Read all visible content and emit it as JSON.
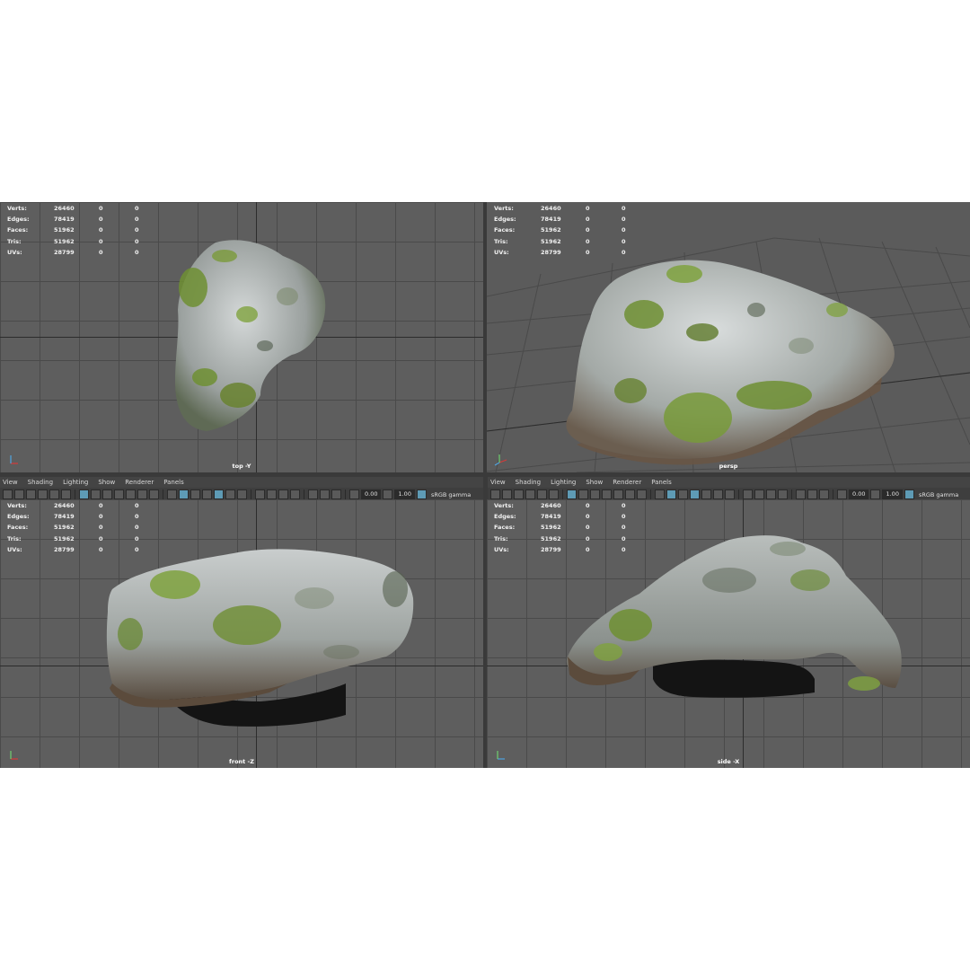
{
  "menu": [
    "View",
    "Shading",
    "Lighting",
    "Show",
    "Renderer",
    "Panels"
  ],
  "toolbar": {
    "exposure": "0.00",
    "gamma": "1.00",
    "color_space": "sRGB gamma"
  },
  "hud": {
    "rows": [
      {
        "label": "Verts:",
        "value": "26460",
        "a": "0",
        "b": "0"
      },
      {
        "label": "Edges:",
        "value": "78419",
        "a": "0",
        "b": "0"
      },
      {
        "label": "Faces:",
        "value": "51962",
        "a": "0",
        "b": "0"
      },
      {
        "label": "Tris:",
        "value": "51962",
        "a": "0",
        "b": "0"
      },
      {
        "label": "UVs:",
        "value": "28799",
        "a": "0",
        "b": "0"
      }
    ]
  },
  "viewports": {
    "top": {
      "camera": "top -Y"
    },
    "persp": {
      "camera": "persp"
    },
    "front": {
      "camera": "front -Z"
    },
    "side": {
      "camera": "side -X"
    }
  },
  "colors": {
    "rock": "#a9aeb0",
    "moss": "#7d9a3a",
    "grid": "#5e5e5e",
    "accent": "#5e9bb5"
  },
  "icons": [
    "camera-icon",
    "wireframe-icon",
    "shaded-icon",
    "texture-icon",
    "light-icon",
    "isolate-icon",
    "xray-icon",
    "axis-gizmo-icon"
  ]
}
